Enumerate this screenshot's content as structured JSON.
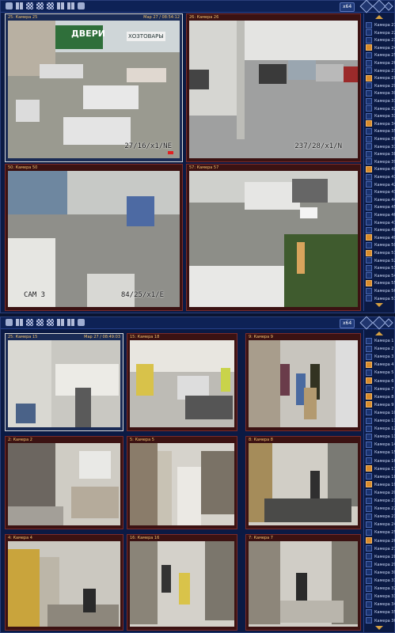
{
  "top": {
    "toolbar": {
      "zoom_label": "x64"
    },
    "cameras": [
      {
        "name": "25: Камера 25",
        "timestamp": "Мар 27 / 08:54:12",
        "osd": "27/16/x1/NE",
        "shop_sign": "ДВЕРИ",
        "shop_sign2": "ХОЗТОВАРЫ"
      },
      {
        "name": "26: Камера 26",
        "timestamp": "",
        "osd": "237/28/x1/N"
      },
      {
        "name": "50: Камера 50",
        "timestamp": "",
        "osd_left": "CAM 3",
        "osd": "84/25/x1/E"
      },
      {
        "name": "57: Камера 57",
        "timestamp": "",
        "osd": ""
      }
    ],
    "side": {
      "items": [
        {
          "n": "21",
          "label": "Камера 21",
          "on": false
        },
        {
          "n": "22",
          "label": "Камера 22",
          "on": false
        },
        {
          "n": "23",
          "label": "Камера 23",
          "on": false
        },
        {
          "n": "24",
          "label": "Камера 24",
          "on": true
        },
        {
          "n": "25",
          "label": "Камера 25",
          "on": false
        },
        {
          "n": "26",
          "label": "Камера 26",
          "on": false
        },
        {
          "n": "27",
          "label": "Камера 27",
          "on": false
        },
        {
          "n": "28",
          "label": "Камера 28",
          "on": true
        },
        {
          "n": "29",
          "label": "Камера 29",
          "on": false
        },
        {
          "n": "30",
          "label": "Камера 30",
          "on": false
        },
        {
          "n": "31",
          "label": "Камера 31",
          "on": false
        },
        {
          "n": "32",
          "label": "Камера 32",
          "on": false
        },
        {
          "n": "33",
          "label": "Камера 33",
          "on": false
        },
        {
          "n": "34",
          "label": "Камера 34",
          "on": true
        },
        {
          "n": "35",
          "label": "Камера 35",
          "on": false
        },
        {
          "n": "36",
          "label": "Камера 36",
          "on": false
        },
        {
          "n": "37",
          "label": "Камера 37",
          "on": false
        },
        {
          "n": "38",
          "label": "Камера 38",
          "on": false
        },
        {
          "n": "39",
          "label": "Камера 39",
          "on": false
        },
        {
          "n": "40",
          "label": "Камера 40",
          "on": true
        },
        {
          "n": "41",
          "label": "Камера 41",
          "on": false
        },
        {
          "n": "42",
          "label": "Камера 42",
          "on": false
        },
        {
          "n": "43",
          "label": "Камера 43",
          "on": false
        },
        {
          "n": "44",
          "label": "Камера 44",
          "on": false
        },
        {
          "n": "45",
          "label": "Камера 45",
          "on": false
        },
        {
          "n": "46",
          "label": "Камера 46",
          "on": false
        },
        {
          "n": "47",
          "label": "Камера 47",
          "on": false
        },
        {
          "n": "48",
          "label": "Камера 48",
          "on": false
        },
        {
          "n": "49",
          "label": "Камера 49",
          "on": true
        },
        {
          "n": "50",
          "label": "Камера 50",
          "on": false
        },
        {
          "n": "51",
          "label": "Камера 51",
          "on": true
        },
        {
          "n": "52",
          "label": "Камера 52",
          "on": false
        },
        {
          "n": "53",
          "label": "Камера 53",
          "on": false
        },
        {
          "n": "54",
          "label": "Камера 54",
          "on": false
        },
        {
          "n": "55",
          "label": "Камера 55",
          "on": true
        },
        {
          "n": "56",
          "label": "Камера 56",
          "on": false
        },
        {
          "n": "57",
          "label": "Камера 57",
          "on": false
        }
      ]
    }
  },
  "bottom": {
    "toolbar": {
      "zoom_label": "x64"
    },
    "cameras": [
      {
        "name": "25: Камера 15",
        "timestamp": "Мар 27 / 08:49:03"
      },
      {
        "name": "15: Камера 18",
        "timestamp": ""
      },
      {
        "name": "9: Камера 9",
        "timestamp": ""
      },
      {
        "name": "2: Камера 2",
        "timestamp": ""
      },
      {
        "name": "5: Камера 5",
        "timestamp": ""
      },
      {
        "name": "8: Камера 8",
        "timestamp": ""
      },
      {
        "name": "4: Камера 4",
        "timestamp": ""
      },
      {
        "name": "16: Камера 16",
        "timestamp": ""
      },
      {
        "name": "7: Камера 7",
        "timestamp": ""
      }
    ],
    "side": {
      "items": [
        {
          "n": "1",
          "label": "Камера 1",
          "on": false
        },
        {
          "n": "2",
          "label": "Камера 2",
          "on": false
        },
        {
          "n": "3",
          "label": "Камера 3",
          "on": false
        },
        {
          "n": "4",
          "label": "Камера 4",
          "on": true
        },
        {
          "n": "5",
          "label": "Камера 5",
          "on": false
        },
        {
          "n": "6",
          "label": "Камера 6",
          "on": true
        },
        {
          "n": "7",
          "label": "Камера 7",
          "on": false
        },
        {
          "n": "8",
          "label": "Камера 8",
          "on": true
        },
        {
          "n": "9",
          "label": "Камера 9",
          "on": true
        },
        {
          "n": "10",
          "label": "Камера 10",
          "on": false
        },
        {
          "n": "11",
          "label": "Камера 11",
          "on": false
        },
        {
          "n": "12",
          "label": "Камера 12",
          "on": false
        },
        {
          "n": "13",
          "label": "Камера 13",
          "on": false
        },
        {
          "n": "14",
          "label": "Камера 14",
          "on": false
        },
        {
          "n": "15",
          "label": "Камера 15",
          "on": false
        },
        {
          "n": "16",
          "label": "Камера 16",
          "on": false
        },
        {
          "n": "17",
          "label": "Камера 17",
          "on": true
        },
        {
          "n": "18",
          "label": "Камера 18",
          "on": false
        },
        {
          "n": "19",
          "label": "Камера 19",
          "on": true
        },
        {
          "n": "20",
          "label": "Камера 20",
          "on": false
        },
        {
          "n": "21",
          "label": "Камера 21",
          "on": false
        },
        {
          "n": "22",
          "label": "Камера 22",
          "on": false
        },
        {
          "n": "23",
          "label": "Камера 23",
          "on": false
        },
        {
          "n": "24",
          "label": "Камера 24",
          "on": false
        },
        {
          "n": "25",
          "label": "Камера 25",
          "on": false
        },
        {
          "n": "26",
          "label": "Камера 26",
          "on": true
        },
        {
          "n": "27",
          "label": "Камера 27",
          "on": false
        },
        {
          "n": "28",
          "label": "Камера 28",
          "on": false
        },
        {
          "n": "29",
          "label": "Камера 29",
          "on": false
        },
        {
          "n": "30",
          "label": "Камера 30",
          "on": false
        },
        {
          "n": "31",
          "label": "Камера 31",
          "on": false
        },
        {
          "n": "32",
          "label": "Камера 32",
          "on": false
        },
        {
          "n": "33",
          "label": "Камера 33",
          "on": false
        },
        {
          "n": "34",
          "label": "Камера 34",
          "on": false
        },
        {
          "n": "35",
          "label": "Камера 35",
          "on": false
        },
        {
          "n": "36",
          "label": "Камера 36",
          "on": false
        }
      ]
    }
  },
  "colors": {
    "accent": "#d98b2b",
    "frame": "#7a2b2b",
    "panel_bg": "#0b1a44"
  }
}
